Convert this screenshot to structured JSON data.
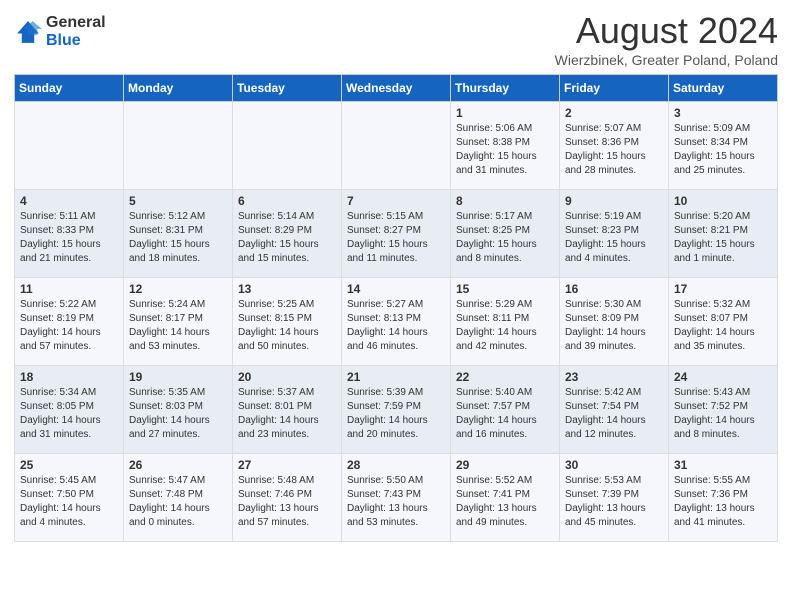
{
  "header": {
    "logo_general": "General",
    "logo_blue": "Blue",
    "month_title": "August 2024",
    "subtitle": "Wierzbinek, Greater Poland, Poland"
  },
  "days_of_week": [
    "Sunday",
    "Monday",
    "Tuesday",
    "Wednesday",
    "Thursday",
    "Friday",
    "Saturday"
  ],
  "weeks": [
    [
      {
        "day": "",
        "info": ""
      },
      {
        "day": "",
        "info": ""
      },
      {
        "day": "",
        "info": ""
      },
      {
        "day": "",
        "info": ""
      },
      {
        "day": "1",
        "info": "Sunrise: 5:06 AM\nSunset: 8:38 PM\nDaylight: 15 hours\nand 31 minutes."
      },
      {
        "day": "2",
        "info": "Sunrise: 5:07 AM\nSunset: 8:36 PM\nDaylight: 15 hours\nand 28 minutes."
      },
      {
        "day": "3",
        "info": "Sunrise: 5:09 AM\nSunset: 8:34 PM\nDaylight: 15 hours\nand 25 minutes."
      }
    ],
    [
      {
        "day": "4",
        "info": "Sunrise: 5:11 AM\nSunset: 8:33 PM\nDaylight: 15 hours\nand 21 minutes."
      },
      {
        "day": "5",
        "info": "Sunrise: 5:12 AM\nSunset: 8:31 PM\nDaylight: 15 hours\nand 18 minutes."
      },
      {
        "day": "6",
        "info": "Sunrise: 5:14 AM\nSunset: 8:29 PM\nDaylight: 15 hours\nand 15 minutes."
      },
      {
        "day": "7",
        "info": "Sunrise: 5:15 AM\nSunset: 8:27 PM\nDaylight: 15 hours\nand 11 minutes."
      },
      {
        "day": "8",
        "info": "Sunrise: 5:17 AM\nSunset: 8:25 PM\nDaylight: 15 hours\nand 8 minutes."
      },
      {
        "day": "9",
        "info": "Sunrise: 5:19 AM\nSunset: 8:23 PM\nDaylight: 15 hours\nand 4 minutes."
      },
      {
        "day": "10",
        "info": "Sunrise: 5:20 AM\nSunset: 8:21 PM\nDaylight: 15 hours\nand 1 minute."
      }
    ],
    [
      {
        "day": "11",
        "info": "Sunrise: 5:22 AM\nSunset: 8:19 PM\nDaylight: 14 hours\nand 57 minutes."
      },
      {
        "day": "12",
        "info": "Sunrise: 5:24 AM\nSunset: 8:17 PM\nDaylight: 14 hours\nand 53 minutes."
      },
      {
        "day": "13",
        "info": "Sunrise: 5:25 AM\nSunset: 8:15 PM\nDaylight: 14 hours\nand 50 minutes."
      },
      {
        "day": "14",
        "info": "Sunrise: 5:27 AM\nSunset: 8:13 PM\nDaylight: 14 hours\nand 46 minutes."
      },
      {
        "day": "15",
        "info": "Sunrise: 5:29 AM\nSunset: 8:11 PM\nDaylight: 14 hours\nand 42 minutes."
      },
      {
        "day": "16",
        "info": "Sunrise: 5:30 AM\nSunset: 8:09 PM\nDaylight: 14 hours\nand 39 minutes."
      },
      {
        "day": "17",
        "info": "Sunrise: 5:32 AM\nSunset: 8:07 PM\nDaylight: 14 hours\nand 35 minutes."
      }
    ],
    [
      {
        "day": "18",
        "info": "Sunrise: 5:34 AM\nSunset: 8:05 PM\nDaylight: 14 hours\nand 31 minutes."
      },
      {
        "day": "19",
        "info": "Sunrise: 5:35 AM\nSunset: 8:03 PM\nDaylight: 14 hours\nand 27 minutes."
      },
      {
        "day": "20",
        "info": "Sunrise: 5:37 AM\nSunset: 8:01 PM\nDaylight: 14 hours\nand 23 minutes."
      },
      {
        "day": "21",
        "info": "Sunrise: 5:39 AM\nSunset: 7:59 PM\nDaylight: 14 hours\nand 20 minutes."
      },
      {
        "day": "22",
        "info": "Sunrise: 5:40 AM\nSunset: 7:57 PM\nDaylight: 14 hours\nand 16 minutes."
      },
      {
        "day": "23",
        "info": "Sunrise: 5:42 AM\nSunset: 7:54 PM\nDaylight: 14 hours\nand 12 minutes."
      },
      {
        "day": "24",
        "info": "Sunrise: 5:43 AM\nSunset: 7:52 PM\nDaylight: 14 hours\nand 8 minutes."
      }
    ],
    [
      {
        "day": "25",
        "info": "Sunrise: 5:45 AM\nSunset: 7:50 PM\nDaylight: 14 hours\nand 4 minutes."
      },
      {
        "day": "26",
        "info": "Sunrise: 5:47 AM\nSunset: 7:48 PM\nDaylight: 14 hours\nand 0 minutes."
      },
      {
        "day": "27",
        "info": "Sunrise: 5:48 AM\nSunset: 7:46 PM\nDaylight: 13 hours\nand 57 minutes."
      },
      {
        "day": "28",
        "info": "Sunrise: 5:50 AM\nSunset: 7:43 PM\nDaylight: 13 hours\nand 53 minutes."
      },
      {
        "day": "29",
        "info": "Sunrise: 5:52 AM\nSunset: 7:41 PM\nDaylight: 13 hours\nand 49 minutes."
      },
      {
        "day": "30",
        "info": "Sunrise: 5:53 AM\nSunset: 7:39 PM\nDaylight: 13 hours\nand 45 minutes."
      },
      {
        "day": "31",
        "info": "Sunrise: 5:55 AM\nSunset: 7:36 PM\nDaylight: 13 hours\nand 41 minutes."
      }
    ]
  ]
}
